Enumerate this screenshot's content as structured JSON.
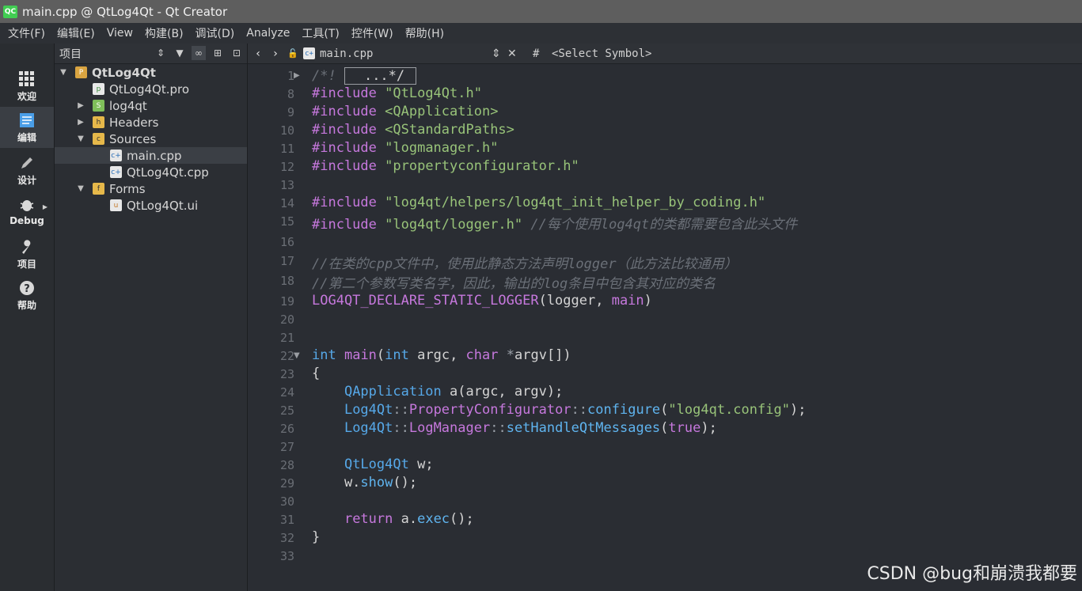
{
  "window": {
    "title": "main.cpp @ QtLog4Qt - Qt Creator",
    "app_icon": "QC"
  },
  "menu": [
    "文件(F)",
    "编辑(E)",
    "View",
    "构建(B)",
    "调试(D)",
    "Analyze",
    "工具(T)",
    "控件(W)",
    "帮助(H)"
  ],
  "modes": [
    {
      "label": "欢迎",
      "icon": "grid-icon"
    },
    {
      "label": "编辑",
      "icon": "document-icon"
    },
    {
      "label": "设计",
      "icon": "pencil-icon"
    },
    {
      "label": "Debug",
      "icon": "bug-icon"
    },
    {
      "label": "项目",
      "icon": "wrench-icon"
    },
    {
      "label": "帮助",
      "icon": "help-icon"
    }
  ],
  "project_panel": {
    "title": "项目",
    "tree": [
      {
        "label": "QtLog4Qt",
        "level": 0,
        "arrow": "▼",
        "icon": "project-icon",
        "bold": true
      },
      {
        "label": "QtLog4Qt.pro",
        "level": 1,
        "arrow": "",
        "icon": "pro-file-icon"
      },
      {
        "label": "log4qt",
        "level": 1,
        "arrow": "▶",
        "icon": "subproject-icon"
      },
      {
        "label": "Headers",
        "level": 1,
        "arrow": "▶",
        "icon": "headers-folder-icon"
      },
      {
        "label": "Sources",
        "level": 1,
        "arrow": "▼",
        "icon": "sources-folder-icon"
      },
      {
        "label": "main.cpp",
        "level": 2,
        "arrow": "",
        "icon": "cpp-file-icon",
        "selected": true
      },
      {
        "label": "QtLog4Qt.cpp",
        "level": 2,
        "arrow": "",
        "icon": "cpp-file-icon"
      },
      {
        "label": "Forms",
        "level": 1,
        "arrow": "▼",
        "icon": "forms-folder-icon"
      },
      {
        "label": "QtLog4Qt.ui",
        "level": 2,
        "arrow": "",
        "icon": "ui-file-icon"
      }
    ]
  },
  "editor": {
    "file_name": "main.cpp",
    "symbol_hash": "#",
    "symbol_selector": "<Select Symbol>",
    "line_numbers": [
      "1",
      "8",
      "9",
      "10",
      "11",
      "12",
      "13",
      "14",
      "15",
      "16",
      "17",
      "18",
      "19",
      "20",
      "21",
      "22",
      "23",
      "24",
      "25",
      "26",
      "27",
      "28",
      "29",
      "30",
      "31",
      "32",
      "33"
    ],
    "lines": [
      "/*! ...*/",
      "#include \"QtLog4Qt.h\"",
      "#include <QApplication>",
      "#include <QStandardPaths>",
      "#include \"logmanager.h\"",
      "#include \"propertyconfigurator.h\"",
      "",
      "#include \"log4qt/helpers/log4qt_init_helper_by_coding.h\"",
      "#include \"log4qt/logger.h\" //每个使用log4qt的类都需要包含此头文件",
      "",
      "//在类的cpp文件中，使用此静态方法声明logger（此方法比较通用）",
      "//第二个参数写类名字，因此，输出的log条目中包含其对应的类名",
      "LOG4QT_DECLARE_STATIC_LOGGER(logger, main)",
      "",
      "",
      "int main(int argc, char *argv[])",
      "{",
      "    QApplication a(argc, argv);",
      "    Log4Qt::PropertyConfigurator::configure(\"log4qt.config\");",
      "    Log4Qt::LogManager::setHandleQtMessages(true);",
      "",
      "    QtLog4Qt w;",
      "    w.show();",
      "",
      "    return a.exec();",
      "}",
      ""
    ]
  },
  "watermark": "CSDN @bug和崩溃我都要"
}
